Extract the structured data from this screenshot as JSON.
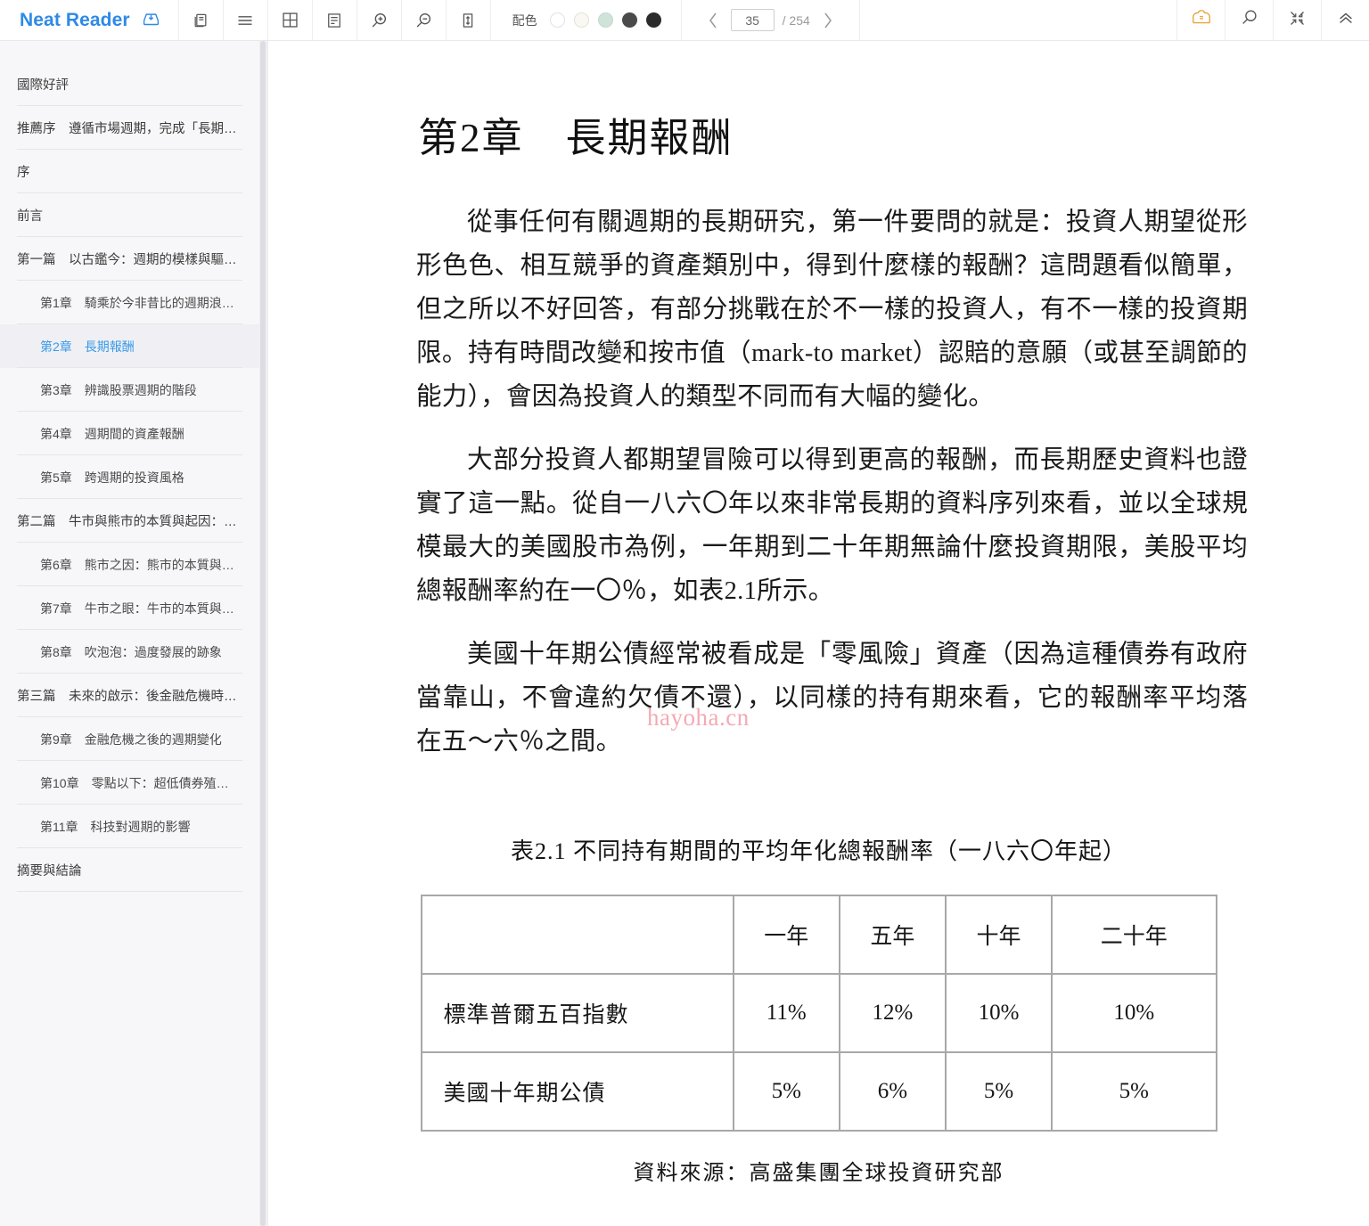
{
  "app": {
    "brand": "Neat Reader"
  },
  "toolbar": {
    "icons": [
      {
        "name": "save-to-library-icon",
        "label": "save-to-library"
      },
      {
        "name": "copy-pages-icon",
        "label": "copy-pages"
      },
      {
        "name": "lines-spacing-icon",
        "label": "line-spacing"
      },
      {
        "name": "grid-layout-icon",
        "label": "grid-layout"
      },
      {
        "name": "single-page-icon",
        "label": "single-page"
      },
      {
        "name": "zoom-in-icon",
        "label": "zoom-in"
      },
      {
        "name": "zoom-out-icon",
        "label": "zoom-out"
      },
      {
        "name": "fit-height-icon",
        "label": "fit-height"
      }
    ],
    "color_scheme": {
      "label": "配色",
      "swatches": [
        "#ffffff",
        "#faf8f2",
        "#cfe3d8",
        "#4a4a4a",
        "#2b2b2b"
      ],
      "selected_index": 0
    },
    "pager": {
      "prev": "‹",
      "current": "35",
      "total": "/ 254",
      "next": "›"
    },
    "right_icons": [
      {
        "name": "bookmark-cloud-icon",
        "label": "bookmark",
        "color": "#e8a33d"
      },
      {
        "name": "search-icon",
        "label": "search"
      },
      {
        "name": "collapse-icon",
        "label": "collapse"
      },
      {
        "name": "chevron-up-icon",
        "label": "hide-toolbar"
      }
    ]
  },
  "sidebar": {
    "items": [
      {
        "label": "國際好評",
        "level": 0,
        "active": false
      },
      {
        "label": "推薦序　遵循市場週期，完成「長期好…",
        "level": 0,
        "active": false
      },
      {
        "label": "序",
        "level": 0,
        "active": false
      },
      {
        "label": "前言",
        "level": 0,
        "active": false
      },
      {
        "label": "第一篇　以古鑑今：週期的模樣與驅動…",
        "level": 0,
        "active": false
      },
      {
        "label": "第1章　騎乘於今非昔比的週期浪…",
        "level": 1,
        "active": false
      },
      {
        "label": "第2章　長期報酬",
        "level": 1,
        "active": true
      },
      {
        "label": "第3章　辨識股票週期的階段",
        "level": 1,
        "active": false
      },
      {
        "label": "第4章　週期間的資產報酬",
        "level": 1,
        "active": false
      },
      {
        "label": "第5章　跨週期的投資風格",
        "level": 1,
        "active": false
      },
      {
        "label": "第二篇　牛市與熊市的本質與起因：導…",
        "level": 0,
        "active": false
      },
      {
        "label": "第6章　熊市之因：熊市的本質與…",
        "level": 1,
        "active": false
      },
      {
        "label": "第7章　牛市之眼：牛市的本質與…",
        "level": 1,
        "active": false
      },
      {
        "label": "第8章　吹泡泡：過度發展的跡象",
        "level": 1,
        "active": false
      },
      {
        "label": "第三篇　未來的啟示：後金融危機時代…",
        "level": 0,
        "active": false
      },
      {
        "label": "第9章　金融危機之後的週期變化",
        "level": 1,
        "active": false
      },
      {
        "label": "第10章　零點以下：超低債券殖…",
        "level": 1,
        "active": false
      },
      {
        "label": "第11章　科技對週期的影響",
        "level": 1,
        "active": false
      },
      {
        "label": "摘要與結論",
        "level": 0,
        "active": false
      }
    ]
  },
  "content": {
    "chapter_title": "第2章　長期報酬",
    "paragraphs": [
      "從事任何有關週期的長期研究，第一件要問的就是：投資人期望從形形色色、相互競爭的資產類別中，得到什麼樣的報酬？這問題看似簡單，但之所以不好回答，有部分挑戰在於不一樣的投資人，有不一樣的投資期限。持有時間改變和按市值（mark-to market）認賠的意願（或甚至調節的能力），會因為投資人的類型不同而有大幅的變化。",
      "大部分投資人都期望冒險可以得到更高的報酬，而長期歷史資料也證實了這一點。從自一八六〇年以來非常長期的資料序列來看，並以全球規模最大的美國股市為例，一年期到二十年期無論什麼投資期限，美股平均總報酬率約在一〇％，如表2.1所示。",
      "美國十年期公債經常被看成是「零風險」資產（因為這種債券有政府當靠山，不會違約欠債不還），以同樣的持有期來看，它的報酬率平均落在五～六％之間。"
    ],
    "watermark": "hayoha.cn",
    "table": {
      "caption": "表2.1 不同持有期間的平均年化總報酬率（一八六〇年起）",
      "columns": [
        "",
        "一年",
        "五年",
        "十年",
        "二十年"
      ],
      "rows": [
        {
          "label": "標準普爾五百指數",
          "values": [
            "11%",
            "12%",
            "10%",
            "10%"
          ]
        },
        {
          "label": "美國十年期公債",
          "values": [
            "5%",
            "6%",
            "5%",
            "5%"
          ]
        }
      ],
      "source": "資料來源：高盛集團全球投資研究部"
    }
  }
}
